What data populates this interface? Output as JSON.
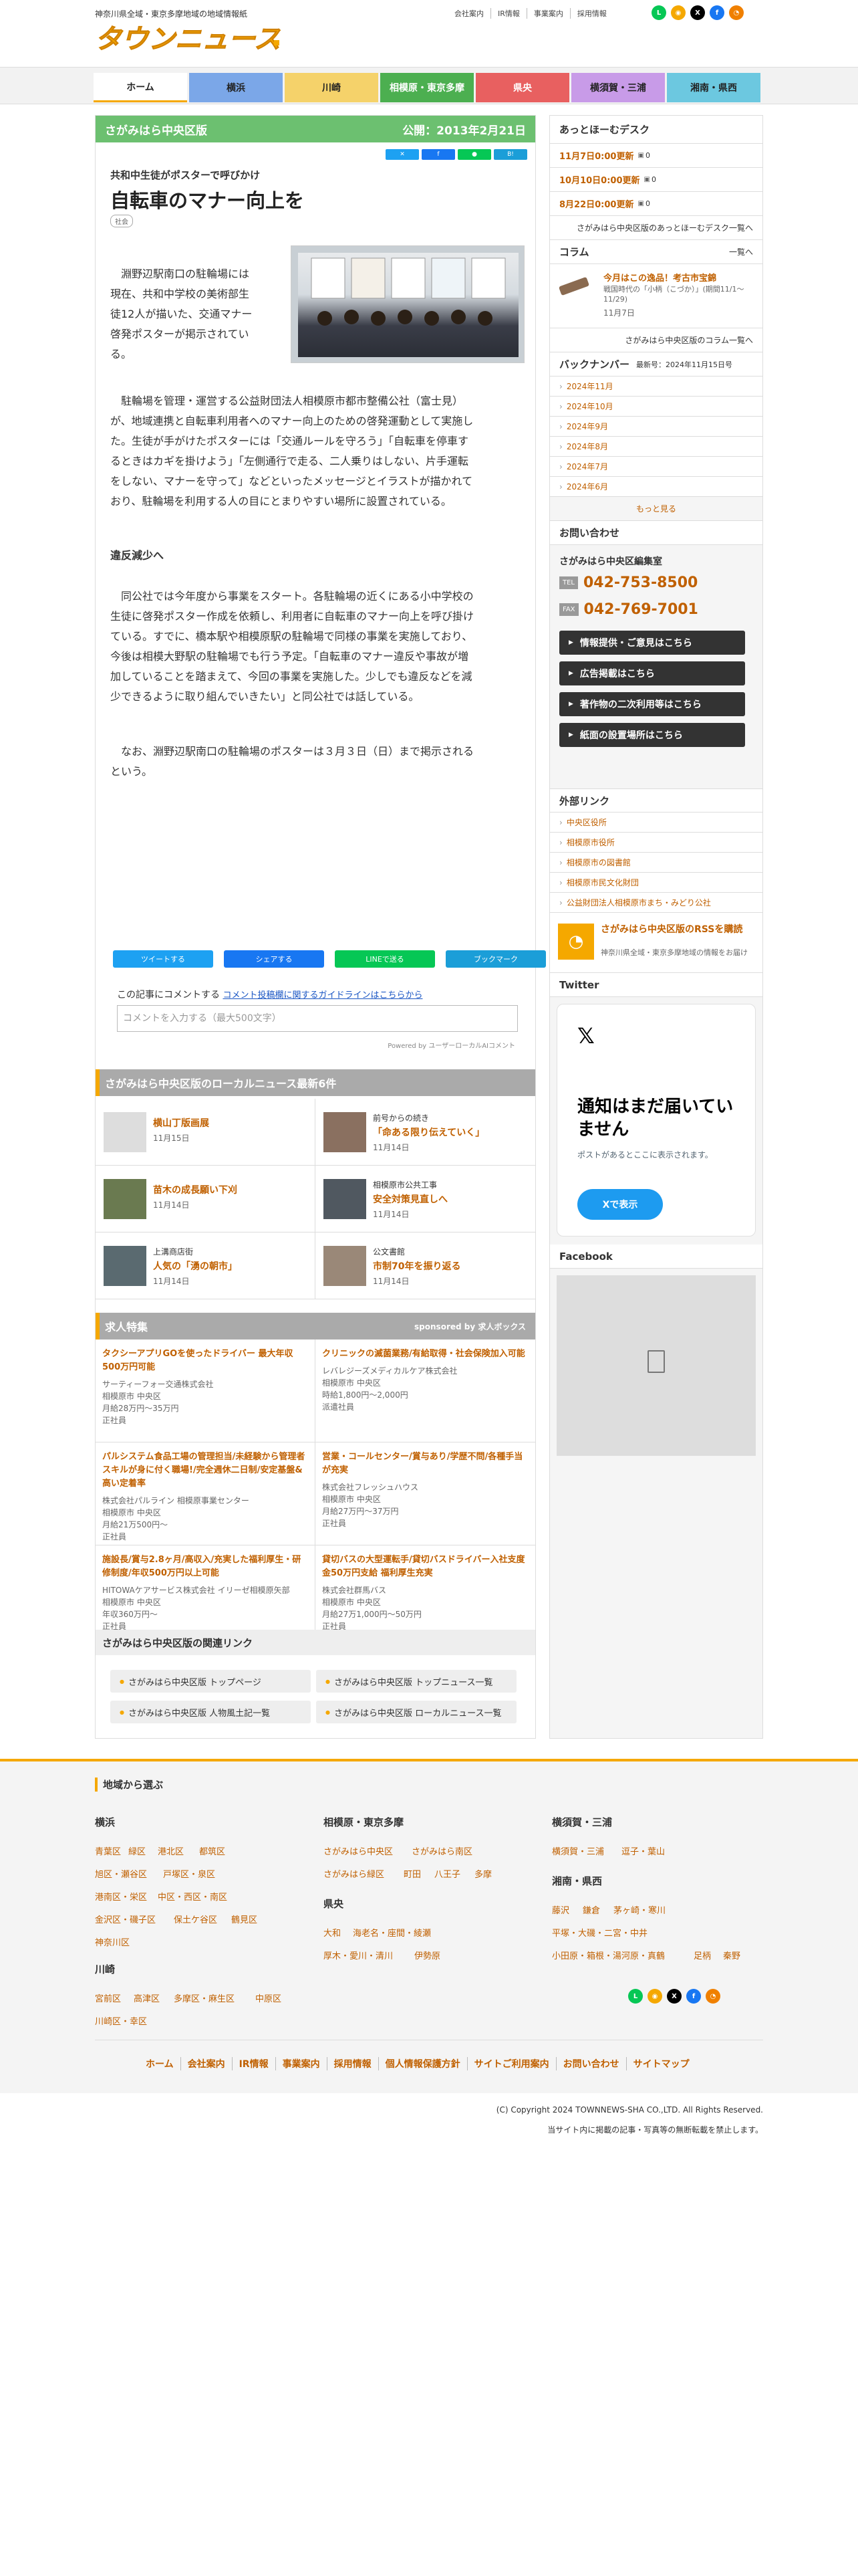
{
  "header": {
    "tagline": "神奈川県全域・東京多摩地域の地域情報紙",
    "logo_text": "タウンニュース",
    "links": [
      "会社案内",
      "IR情報",
      "事業案内",
      "採用情報"
    ],
    "social_icons": [
      "line-icon",
      "rss-icon",
      "x-icon",
      "facebook-icon",
      "rss-icon"
    ]
  },
  "nav": {
    "tabs": [
      {
        "label": "ホーム",
        "color": "#ffffff"
      },
      {
        "label": "横浜",
        "color": "#7ba7e8"
      },
      {
        "label": "川崎",
        "color": "#f5d26a"
      },
      {
        "label": "相模原・東京多摩",
        "color": "#4caf50"
      },
      {
        "label": "県央",
        "color": "#e86060"
      },
      {
        "label": "横須賀・三浦",
        "color": "#c89be8"
      },
      {
        "label": "湘南・県西",
        "color": "#6cc8e0"
      }
    ]
  },
  "article": {
    "section": "さがみはら中央区版",
    "published": "公開：2013年2月21日",
    "share_small": [
      "",
      "",
      "",
      ""
    ],
    "subtitle": "共和中生徒がポスターで呼びかけ",
    "title": "自転車のマナー向上を",
    "tag": "社会",
    "p1": [
      "　淵野辺駅南口の駐輪場には",
      "現在、共和中学校の美術部生",
      "徒12人が描いた、交通マナー",
      "啓発ポスターが掲示されてい",
      "る。"
    ],
    "p2": [
      "　駐輪場を管理・運営する公益財団法人相模原市都市整備公社（富士見）",
      "が、地域連携と自転車利用者へのマナー向上のための啓発運動として実施し",
      "た。生徒が手がけたポスターには「交通ルールを守ろう」「自転車を停車す",
      "るときはカギを掛けよう」「左側通行で走る、二人乗りはしない、片手運転",
      "をしない、マナーを守って」などといったメッセージとイラストが描かれて",
      "おり、駐輪場を利用する人の目にとまりやすい場所に設置されている。"
    ],
    "subhead": "違反減少へ",
    "p3": [
      "　同公社では今年度から事業をスタート。各駐輪場の近くにある小中学校の",
      "生徒に啓発ポスター作成を依頼し、利用者に自転車のマナー向上を呼び掛け",
      "ている。すでに、橋本駅や相模原駅の駐輪場で同様の事業を実施しており、",
      "今後は相模大野駅の駐輪場でも行う予定。「自転車のマナー違反や事故が増",
      "加していることを踏まえて、今回の事業を実施した。少しでも違反などを減",
      "少できるように取り組んでいきたい」と同公社では話している。"
    ],
    "p4": [
      "　なお、淵野辺駅南口の駐輪場のポスターは３月３日（日）まで掲示される",
      "という。"
    ],
    "share_bar": [
      "ツイートする",
      "シェアする",
      "LINEで送る",
      "ブックマーク"
    ],
    "comment_label": "この記事にコメントする",
    "comment_link": "コメント投稿欄に関するガイドラインはこちらから",
    "comment_placeholder": "コメントを入力する（最大500文字）",
    "powered": "Powered by ユーザーローカルAIコメント"
  },
  "local_news": {
    "heading": "さがみはら中央区版のローカルニュース最新6件",
    "items": [
      {
        "caption": "",
        "title": "横山丁版画展",
        "date": "11月15日"
      },
      {
        "caption": "前号からの続き",
        "title": "「命ある限り伝えていく」",
        "date": "11月14日"
      },
      {
        "caption": "",
        "title": "苗木の成長願い下刈",
        "date": "11月14日"
      },
      {
        "caption": "相模原市公共工事",
        "title": "安全対策見直しへ",
        "date": "11月14日"
      },
      {
        "caption": "上溝商店街",
        "title": "人気の「湧の朝市」",
        "date": "11月14日"
      },
      {
        "caption": "公文書館",
        "title": "市制70年を振り返る",
        "date": "11月14日"
      }
    ]
  },
  "jobs": {
    "heading": "求人特集",
    "sponsor": "sponsored by 求人ボックス",
    "items": [
      {
        "title": "タクシーアプリGOを使ったドライバー 最大年収500万円可能",
        "company": "サーティーフォー交通株式会社",
        "loc": "相模原市 中央区",
        "pay": "月給28万円～35万円",
        "type": "正社員"
      },
      {
        "title": "クリニックの滅菌業務/有給取得・社会保険加入可能",
        "company": "レバレジーズメディカルケア株式会社",
        "loc": "相模原市 中央区",
        "pay": "時給1,800円～2,000円",
        "type": "派遣社員"
      },
      {
        "title": "パルシステム食品工場の管理担当/未経験から管理者スキルが身に付く職場!/完全週休二日制/安定基盤&高い定着率",
        "company": "株式会社パルライン 相模原事業センター",
        "loc": "相模原市 中央区",
        "pay": "月給21万500円～",
        "type": "正社員"
      },
      {
        "title": "営業・コールセンター/賞与あり/学歴不問/各種手当が充実",
        "company": "株式会社フレッシュハウス",
        "loc": "相模原市 中央区",
        "pay": "月給27万円～37万円",
        "type": "正社員"
      },
      {
        "title": "施設長/賞与2.8ヶ月/高収入/充実した福利厚生・研修制度/年収500万円以上可能",
        "company": "HITOWAケアサービス株式会社 イリーゼ相模原矢部",
        "loc": "相模原市 中央区",
        "pay": "年収360万円～",
        "type": "正社員"
      },
      {
        "title": "貸切バスの大型運転手/貸切バスドライバー入社支度金50万円支給 福利厚生充実",
        "company": "株式会社群馬バス",
        "loc": "相模原市 中央区",
        "pay": "月給27万1,000円～50万円",
        "type": "正社員"
      }
    ]
  },
  "related": {
    "heading": "さがみはら中央区版の関連リンク",
    "links": [
      "さがみはら中央区版 トップページ",
      "さがみはら中央区版 トップニュース一覧",
      "さがみはら中央区版 人物風土記一覧",
      "さがみはら中央区版 ローカルニュース一覧"
    ]
  },
  "sidebar": {
    "desk_heading": "あっとほーむデスク",
    "desk_items": [
      {
        "label": "11月7日0:00更新",
        "count": "0"
      },
      {
        "label": "10月10日0:00更新",
        "count": "0"
      },
      {
        "label": "8月22日0:00更新",
        "count": "0"
      }
    ],
    "desk_more": "さがみはら中央区版のあっとほーむデスク一覧へ",
    "column_heading": "コラム",
    "column_more": "一覧へ",
    "column_title": "今月はこの逸品！考古市宝錦",
    "column_desc": "戦国時代の「小柄（こづか）」(期間11/1～11/29)",
    "column_date": "11月7日",
    "column_link": "さがみはら中央区版のコラム一覧へ",
    "backnum_heading": "バックナンバー",
    "backnum_latest": "最新号：2024年11月15日号",
    "backnums": [
      "2024年11月",
      "2024年10月",
      "2024年9月",
      "2024年8月",
      "2024年7月",
      "2024年6月"
    ],
    "backnum_more": "もっと見る",
    "contact_heading": "お問い合わせ",
    "contact_office": "さがみはら中央区編集室",
    "tel_label": "TEL",
    "tel": "042-753-8500",
    "fax_label": "FAX",
    "fax": "042-769-7001",
    "buttons": [
      "情報提供・ご意見はこちら",
      "広告掲載はこちら",
      "著作物の二次利用等はこちら",
      "紙面の設置場所はこちら"
    ],
    "ext_heading": "外部リンク",
    "ext_links": [
      "中央区役所",
      "相模原市役所",
      "相模原市の図書館",
      "相模原市民文化財団",
      "公益財団法人相模原市まち・みどり公社"
    ],
    "rss_title": "さがみはら中央区版のRSSを購読",
    "rss_desc": "神奈川県全域・東京多摩地域の情報をお届け",
    "twitter_heading": "Twitter",
    "twitter_msg": "通知はまだ届いていません",
    "twitter_sub": "ポストがあるとここに表示されます。",
    "twitter_btn": "Xで表示",
    "facebook_heading": "Facebook"
  },
  "footer": {
    "region_heading": "地域から選ぶ",
    "yokohama_heading": "横浜",
    "yokohama_links": [
      "青葉区",
      "緑区",
      "港北区",
      "都筑区",
      "旭区・瀬谷区",
      "戸塚区・泉区",
      "港南区・栄区",
      "中区・西区・南区",
      "金沢区・磯子区",
      "保土ケ谷区",
      "鶴見区",
      "神奈川区"
    ],
    "kawasaki_heading": "川崎",
    "kawasaki_links": [
      "宮前区",
      "高津区",
      "多摩区・麻生区",
      "中原区",
      "川崎区・幸区"
    ],
    "sagami_heading": "相模原・東京多摩",
    "sagami_links": [
      "さがみはら中央区",
      "さがみはら南区",
      "さがみはら緑区",
      "町田",
      "八王子",
      "多摩"
    ],
    "kenou_heading": "県央",
    "kenou_links": [
      "大和",
      "海老名・座間・綾瀬",
      "厚木・愛川・清川",
      "伊勢原"
    ],
    "yokosuka_heading": "横須賀・三浦",
    "yokosuka_links": [
      "横須賀・三浦",
      "逗子・葉山"
    ],
    "shonan_heading": "湘南・県西",
    "shonan_links": [
      "藤沢",
      "鎌倉",
      "茅ヶ崎・寒川",
      "平塚・大磯・二宮・中井",
      "小田原・箱根・湯河原・真鶴",
      "足柄",
      "秦野"
    ],
    "bottom_links": [
      "ホーム",
      "会社案内",
      "IR情報",
      "事業案内",
      "採用情報",
      "個人情報保護方針",
      "サイトご利用案内",
      "お問い合わせ",
      "サイトマップ"
    ],
    "copyright": "(C) Copyright 2024 TOWNNEWS-SHA CO.,LTD. All Rights Reserved.",
    "notice": "当サイト内に掲載の記事・写真等の無断転載を禁止します。"
  }
}
